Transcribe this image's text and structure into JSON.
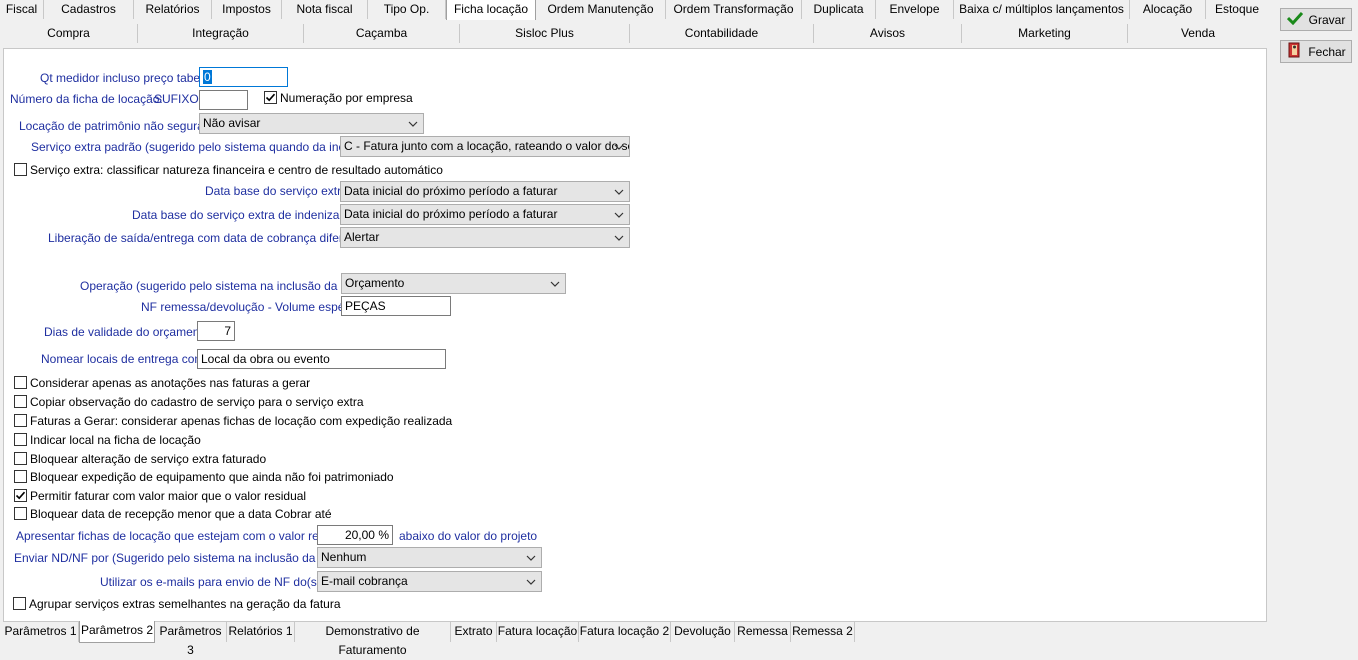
{
  "tabs_row1": [
    {
      "label": "Fiscal"
    },
    {
      "label": "Cadastros"
    },
    {
      "label": "Relatórios"
    },
    {
      "label": "Impostos"
    },
    {
      "label": "Nota fiscal"
    },
    {
      "label": "Tipo Op."
    },
    {
      "label": "Ficha locação",
      "active": true
    },
    {
      "label": "Ordem Manutenção"
    },
    {
      "label": "Ordem Transformação"
    },
    {
      "label": "Duplicata"
    },
    {
      "label": "Envelope"
    },
    {
      "label": "Baixa c/ múltiplos lançamentos"
    },
    {
      "label": "Alocação"
    },
    {
      "label": "Estoque"
    }
  ],
  "tabs_row2": [
    {
      "label": "Compra"
    },
    {
      "label": "Integração"
    },
    {
      "label": "Caçamba"
    },
    {
      "label": "Sisloc Plus"
    },
    {
      "label": "Contabilidade"
    },
    {
      "label": "Avisos"
    },
    {
      "label": "Marketing"
    },
    {
      "label": "Venda"
    }
  ],
  "buttons": {
    "gravar": "Gravar",
    "fechar": "Fechar"
  },
  "form": {
    "qt_medidor_label": "Qt medidor incluso preço tabela",
    "qt_medidor_value": "0",
    "numero_ficha_label": "Número da ficha de locação:",
    "sufixo_label": "SUFIXO:",
    "sufixo_value": "",
    "numeracao_empresa_label": "Numeração por empresa",
    "numeracao_empresa_checked": true,
    "locacao_patrimonio_label": "Locação de patrimônio não segurado",
    "locacao_patrimonio_value": "Não avisar",
    "servico_extra_padrao_label": "Serviço extra padrão (sugerido pelo sistema quando da inclusão)",
    "servico_extra_padrao_value": "C - Fatura junto com a locação, rateando o valor do serviço",
    "classificar_natureza_label": "Serviço extra: classificar natureza financeira e centro de resultado automático",
    "classificar_natureza_checked": false,
    "data_base_servico_label": "Data base do serviço extra",
    "data_base_servico_value": "Data inicial do próximo período a faturar",
    "data_base_indenizacao_label": "Data base do serviço extra de indenização",
    "data_base_indenizacao_value": "Data inicial do próximo período a faturar",
    "liberacao_saida_label": "Liberação de saída/entrega com data de cobrança diferente",
    "liberacao_saida_value": "Alertar",
    "operacao_label": "Operação (sugerido pelo sistema na inclusão da ficha)",
    "operacao_value": "Orçamento",
    "nf_remessa_label": "NF remessa/devolução - Volume espécie",
    "nf_remessa_value": "PEÇAS",
    "dias_validade_label": "Dias de validade do orçamento",
    "dias_validade_value": "7",
    "nomear_locais_label": "Nomear locais de entrega como:",
    "nomear_locais_value": "Local da obra ou evento",
    "checks": [
      {
        "label": "Considerar apenas as anotações nas faturas a gerar",
        "checked": false
      },
      {
        "label": "Copiar observação do cadastro de serviço para o serviço extra",
        "checked": false
      },
      {
        "label": "Faturas a Gerar: considerar apenas fichas de locação com expedição realizada",
        "checked": false
      },
      {
        "label": "Indicar local na ficha de locação",
        "checked": false
      },
      {
        "label": "Bloquear alteração de serviço extra faturado",
        "checked": false
      },
      {
        "label": "Bloquear expedição de equipamento que ainda não foi patrimoniado",
        "checked": false
      },
      {
        "label": "Permitir faturar com valor maior que o valor residual",
        "checked": true
      },
      {
        "label": "Bloquear data de recepção menor que a data Cobrar até",
        "checked": false
      }
    ],
    "apresentar_fichas_label": "Apresentar fichas de locação que estejam com o valor residual",
    "apresentar_fichas_value": "20,00 %",
    "abaixo_valor_label": "abaixo do valor do projeto",
    "enviar_nd_label": "Enviar ND/NF por (Sugerido pelo sistema na inclusão da ficha",
    "enviar_nd_value": "Nenhum",
    "utilizar_emails_label": "Utilizar os e-mails para envio de NF do(s)",
    "utilizar_emails_value": "E-mail cobrança",
    "agrupar_label": "Agrupar serviços extras semelhantes na geração da fatura",
    "agrupar_checked": false
  },
  "bottom_tabs": [
    {
      "label": "Parâmetros 1"
    },
    {
      "label": "Parâmetros 2",
      "active": true
    },
    {
      "label": "Parâmetros 3"
    },
    {
      "label": "Relatórios 1"
    },
    {
      "label": "Demonstrativo de Faturamento"
    },
    {
      "label": "Extrato"
    },
    {
      "label": "Fatura locação"
    },
    {
      "label": "Fatura locação 2"
    },
    {
      "label": "Devolução"
    },
    {
      "label": "Remessa"
    },
    {
      "label": "Remessa 2"
    }
  ]
}
